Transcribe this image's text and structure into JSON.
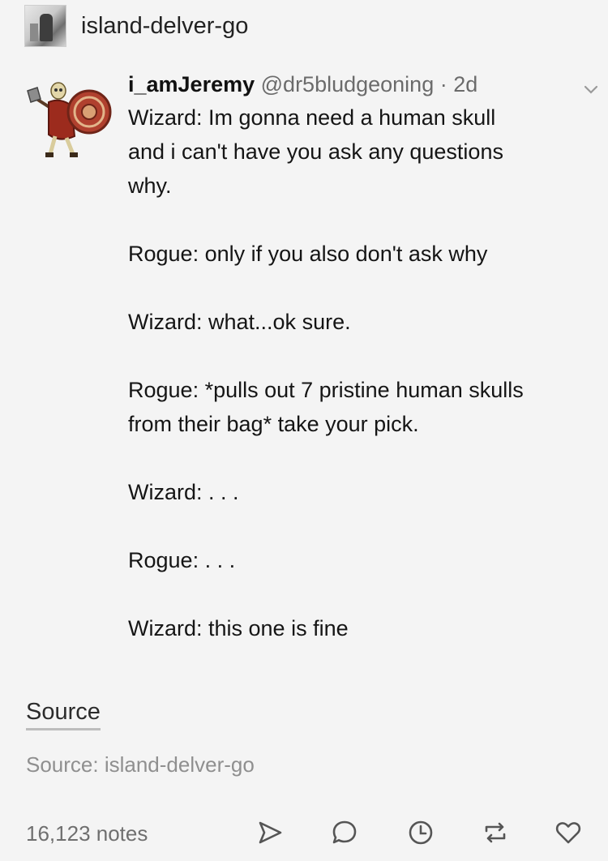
{
  "header": {
    "blog_name": "island-delver-go"
  },
  "tweet": {
    "display_name": "i_amJeremy",
    "handle": "@dr5bludgeoning",
    "separator": "·",
    "age": "2d",
    "paragraphs": [
      [
        "Wizard: Im gonna need a human skull",
        "and i can't have you ask any questions",
        "why."
      ],
      [
        "Rogue: only if you also don't ask why"
      ],
      [
        "Wizard: what...ok sure."
      ],
      [
        "Rogue: *pulls out 7 pristine human skulls",
        "from their bag* take your pick."
      ],
      [
        "Wizard: . . ."
      ],
      [
        "Rogue: . . ."
      ],
      [
        "Wizard: this one is fine"
      ]
    ]
  },
  "source": {
    "link_label": "Source",
    "text": "Source: island-delver-go"
  },
  "footer": {
    "notes": "16,123 notes",
    "actions": [
      "share-icon",
      "reply-icon",
      "clock-icon",
      "reblog-icon",
      "heart-icon"
    ]
  },
  "colors": {
    "background": "#f4f4f4",
    "muted": "#6f6f6f",
    "text": "#151515"
  }
}
